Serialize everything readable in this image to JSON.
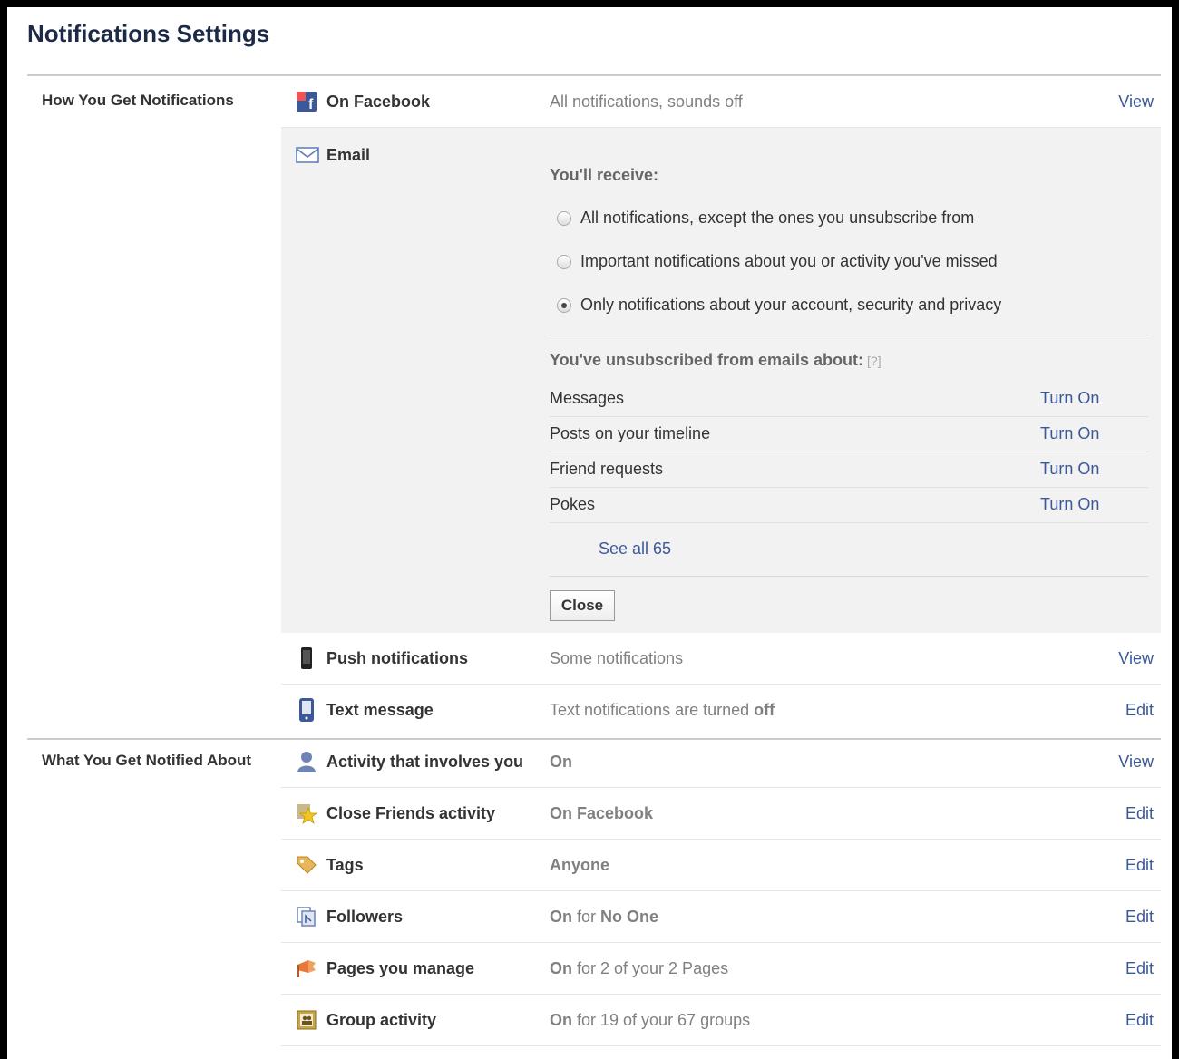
{
  "page": {
    "title": "Notifications Settings"
  },
  "how": {
    "label": "How You Get Notifications",
    "on_facebook": {
      "name": "On Facebook",
      "value": "All notifications, sounds off",
      "action": "View",
      "icon": "facebook-icon"
    },
    "email": {
      "name": "Email",
      "icon": "envelope-icon",
      "receive_label": "You'll receive:",
      "options": [
        {
          "label": "All notifications, except the ones you unsubscribe from",
          "checked": false
        },
        {
          "label": "Important notifications about you or activity you've missed",
          "checked": false
        },
        {
          "label": "Only notifications about your account, security and privacy",
          "checked": true
        }
      ],
      "unsubscribed_label": "You've unsubscribed from emails about:",
      "help": "[?]",
      "unsubscribed": [
        {
          "label": "Messages",
          "action": "Turn On"
        },
        {
          "label": "Posts on your timeline",
          "action": "Turn On"
        },
        {
          "label": "Friend requests",
          "action": "Turn On"
        },
        {
          "label": "Pokes",
          "action": "Turn On"
        }
      ],
      "see_all": "See all 65",
      "close": "Close"
    },
    "push": {
      "name": "Push notifications",
      "value": "Some notifications",
      "action": "View",
      "icon": "phone-icon"
    },
    "text": {
      "name": "Text message",
      "value_prefix": "Text notifications are turned ",
      "value_bold": "off",
      "action": "Edit",
      "icon": "mobile-icon"
    }
  },
  "what": {
    "label": "What You Get Notified About",
    "items": [
      {
        "name": "Activity that involves you",
        "value_bold": "On",
        "value_rest": "",
        "action": "View",
        "icon": "person-icon"
      },
      {
        "name": "Close Friends activity",
        "value_bold": "On Facebook",
        "value_rest": "",
        "action": "Edit",
        "icon": "star-icon"
      },
      {
        "name": "Tags",
        "value_bold": "Anyone",
        "value_rest": "",
        "action": "Edit",
        "icon": "tag-icon"
      },
      {
        "name": "Followers",
        "value_bold": "On",
        "value_rest": " for ",
        "value_bold2": "No One",
        "action": "Edit",
        "icon": "followers-icon"
      },
      {
        "name": "Pages you manage",
        "value_bold": "On",
        "value_rest": " for 2 of your 2 Pages",
        "action": "Edit",
        "icon": "flag-icon"
      },
      {
        "name": "Group activity",
        "value_bold": "On",
        "value_rest": " for 19 of your 67 groups",
        "action": "Edit",
        "icon": "group-icon"
      }
    ]
  },
  "colors": {
    "link": "#3b5998",
    "title": "#1c2a47",
    "panel": "#f2f2f2"
  }
}
